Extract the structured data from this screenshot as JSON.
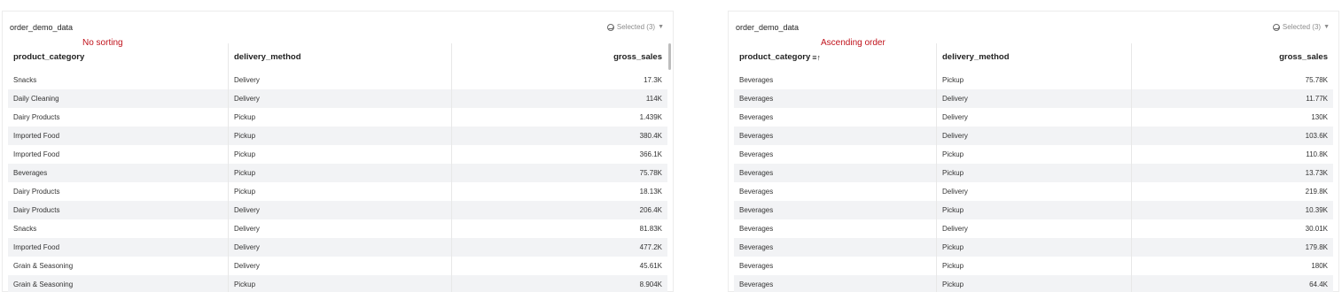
{
  "left": {
    "title": "order_demo_data",
    "selector_label": "Selected (3)",
    "annotation": "No sorting",
    "columns": [
      "product_category",
      "delivery_method",
      "gross_sales"
    ],
    "rows": [
      [
        "Snacks",
        "Delivery",
        "17.3K"
      ],
      [
        "Daily Cleaning",
        "Delivery",
        "114K"
      ],
      [
        "Dairy Products",
        "Pickup",
        "1.439K"
      ],
      [
        "Imported Food",
        "Pickup",
        "380.4K"
      ],
      [
        "Imported Food",
        "Pickup",
        "366.1K"
      ],
      [
        "Beverages",
        "Pickup",
        "75.78K"
      ],
      [
        "Dairy Products",
        "Pickup",
        "18.13K"
      ],
      [
        "Dairy Products",
        "Delivery",
        "206.4K"
      ],
      [
        "Snacks",
        "Delivery",
        "81.83K"
      ],
      [
        "Imported Food",
        "Delivery",
        "477.2K"
      ],
      [
        "Grain & Seasoning",
        "Delivery",
        "45.61K"
      ],
      [
        "Grain & Seasoning",
        "Pickup",
        "8.904K"
      ]
    ]
  },
  "right": {
    "title": "order_demo_data",
    "selector_label": "Selected (3)",
    "annotation": "Ascending order",
    "columns": [
      "product_category",
      "delivery_method",
      "gross_sales"
    ],
    "sort_icon": "≡↑",
    "rows": [
      [
        "Beverages",
        "Pickup",
        "75.78K"
      ],
      [
        "Beverages",
        "Delivery",
        "11.77K"
      ],
      [
        "Beverages",
        "Delivery",
        "130K"
      ],
      [
        "Beverages",
        "Delivery",
        "103.6K"
      ],
      [
        "Beverages",
        "Pickup",
        "110.8K"
      ],
      [
        "Beverages",
        "Pickup",
        "13.73K"
      ],
      [
        "Beverages",
        "Delivery",
        "219.8K"
      ],
      [
        "Beverages",
        "Pickup",
        "10.39K"
      ],
      [
        "Beverages",
        "Delivery",
        "30.01K"
      ],
      [
        "Beverages",
        "Pickup",
        "179.8K"
      ],
      [
        "Beverages",
        "Pickup",
        "180K"
      ],
      [
        "Beverages",
        "Pickup",
        "64.4K"
      ]
    ]
  }
}
